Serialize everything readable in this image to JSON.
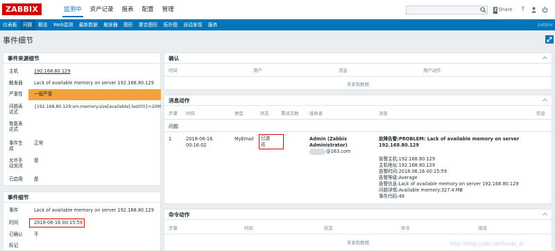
{
  "logo": "ZABBIX",
  "main_menu": [
    "监测中",
    "资产记录",
    "报表",
    "配置",
    "管理"
  ],
  "search": {
    "placeholder": ""
  },
  "share_label": "Share",
  "sub_menu": [
    "仪表板",
    "问题",
    "概览",
    "Web监测",
    "最新数据",
    "触发器",
    "图形",
    "聚合图形",
    "拓扑图",
    "自动发现",
    "服务"
  ],
  "sub_menu_right": "zabbix",
  "page_title": "事件细节",
  "source_panel": {
    "title": "事件来源细节",
    "rows": [
      {
        "label": "主机",
        "value": "192.168.80.129"
      },
      {
        "label": "触发器",
        "value": "Lack of available memory on server 192.168.80.129"
      },
      {
        "label": "严重性",
        "value": "一般严重"
      },
      {
        "label": "问题表达式",
        "value": "{192.168.80.129:vm.memory.size[available].last(0)}<20M"
      },
      {
        "label": "恢复表达式",
        "value": ""
      },
      {
        "label": "事件生成",
        "value": "正常"
      },
      {
        "label": "允许手动关闭",
        "value": "是"
      },
      {
        "label": "已启用",
        "value": "是"
      }
    ]
  },
  "event_panel": {
    "title": "事件细节",
    "rows": [
      {
        "label": "事件",
        "value": "Lack of available memory on server 192.168.80.129"
      },
      {
        "label": "时间",
        "value": "2018-06-16 00:15:59"
      },
      {
        "label": "已确认",
        "value": "不"
      },
      {
        "label": "标记",
        "value": ""
      }
    ]
  },
  "ack_panel": {
    "title": "确认",
    "columns": [
      "时间",
      "用户",
      "消息",
      "用户动作"
    ],
    "empty": "未发现数据"
  },
  "msg_panel": {
    "title": "消息动作",
    "columns": [
      "步骤",
      "时间",
      "类型",
      "状态",
      "重试次数",
      "接收者",
      "消息",
      "信息"
    ],
    "group": "问题",
    "row": {
      "step": "1",
      "time_date": "2018-06-16",
      "time_clock": "00:16:02",
      "type": "MyEmail",
      "status_1": "已送",
      "status_2": "达",
      "recipient_name": "Admin (Zabbix",
      "recipient_name2": "Administrator)",
      "recipient_email": "@163.com",
      "subject": "故障告警:PROBLEM: Lack of available memory on server",
      "subject2": "192.168.80.129",
      "body": [
        "告警主机:192.168.80.129",
        "主机地址:192.168.80.129",
        "告警时间:2018.06.16 00:15:59",
        "告警等级:Average",
        "告警信息:Lack of available memory on server 192.168.80.129",
        "问题详情:Available memory:327.4 MB",
        "事件代码:49"
      ]
    }
  },
  "cmd_panel": {
    "title": "命令动作",
    "columns": [
      "步骤",
      "时间",
      "状态",
      "命令",
      "错误"
    ],
    "empty": "未发现数据"
  },
  "watermark": "http://blog.csdn.net/lusdo_di",
  "colors": {
    "brand": "#d40000",
    "accent": "#0275b8",
    "severity_average": "#f4a23d",
    "ok": "#3a9c3a"
  }
}
